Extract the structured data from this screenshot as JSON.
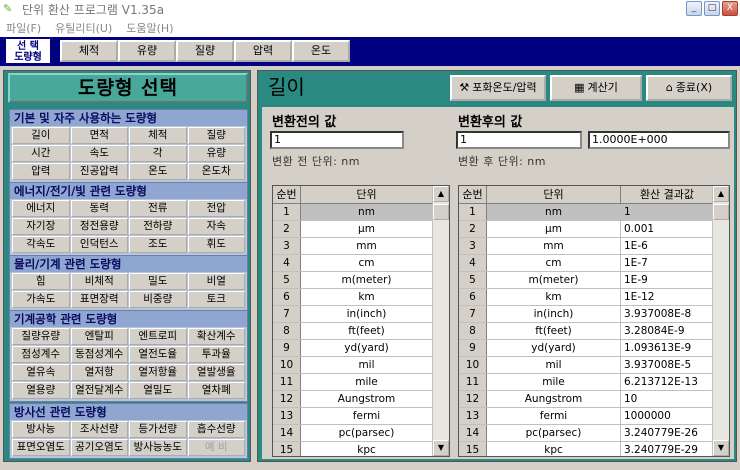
{
  "window": {
    "title": "단위 환산 프로그램 V1.35a",
    "minimize_label": "_",
    "maximize_label": "□",
    "close_label": "X"
  },
  "menu": [
    "파일(F)",
    "유틸리티(U)",
    "도움말(H)"
  ],
  "topbar": {
    "select_label_line1": "선 택",
    "select_label_line2": "도량형",
    "categories": [
      "체적",
      "유량",
      "질량",
      "압력",
      "온도"
    ]
  },
  "left_panel": {
    "header": "도량형 선택",
    "groups": [
      {
        "title": "기본 및 자주 사용하는 도량형",
        "items": [
          "길이",
          "면적",
          "체적",
          "질량",
          "시간",
          "속도",
          "각",
          "유량",
          "압력",
          "진공압력",
          "온도",
          "온도차"
        ]
      },
      {
        "title": "에너지/전기/빛 관련 도량형",
        "items": [
          "에너지",
          "동력",
          "전류",
          "전압",
          "자기장",
          "정전용량",
          "전하량",
          "자속",
          "각속도",
          "인덕턴스",
          "조도",
          "휘도"
        ]
      },
      {
        "title": "물리/기계 관련 도량형",
        "items": [
          "힘",
          "비체적",
          "밀도",
          "비열",
          "가속도",
          "표면장력",
          "비중량",
          "토크"
        ]
      },
      {
        "title": "기계공학 관련 도량형",
        "items": [
          "질량유량",
          "엔탈피",
          "엔트로피",
          "확산계수",
          "점성계수",
          "동점성계수",
          "열전도율",
          "투과율",
          "열유속",
          "열저항",
          "열저항율",
          "열발생율",
          "열용량",
          "열전달계수",
          "열밀도",
          "열차폐"
        ]
      },
      {
        "title": "방사선 관련 도량형",
        "items": [
          "방사능",
          "조사선량",
          "등가선량",
          "흡수선량",
          "표면오염도",
          "공기오염도",
          "방사능농도",
          "예 비"
        ]
      }
    ]
  },
  "right_panel": {
    "title": "길이",
    "btn_temp": "포화온도/압력",
    "btn_calc": "계산기",
    "btn_exit": "종료(X)",
    "before_label": "변환전의 값",
    "before_value": "1",
    "before_unit_label": "변환 전 단위: nm",
    "after_label": "변환후의 값",
    "after_value": "1",
    "after_result": "1.0000E+000",
    "after_unit_label": "변환 후 단위: nm"
  },
  "left_table": {
    "headers": [
      "순번",
      "단위"
    ],
    "rows": [
      [
        "1",
        "nm"
      ],
      [
        "2",
        "μm"
      ],
      [
        "3",
        "mm"
      ],
      [
        "4",
        "cm"
      ],
      [
        "5",
        "m(meter)"
      ],
      [
        "6",
        "km"
      ],
      [
        "7",
        "in(inch)"
      ],
      [
        "8",
        "ft(feet)"
      ],
      [
        "9",
        "yd(yard)"
      ],
      [
        "10",
        "mil"
      ],
      [
        "11",
        "mile"
      ],
      [
        "12",
        "Aungstrom"
      ],
      [
        "13",
        "fermi"
      ],
      [
        "14",
        "pc(parsec)"
      ],
      [
        "15",
        "kpc"
      ]
    ]
  },
  "right_table": {
    "headers": [
      "순번",
      "단위",
      "환산 결과값"
    ],
    "rows": [
      [
        "1",
        "nm",
        "1"
      ],
      [
        "2",
        "μm",
        "0.001"
      ],
      [
        "3",
        "mm",
        "1E-6"
      ],
      [
        "4",
        "cm",
        "1E-7"
      ],
      [
        "5",
        "m(meter)",
        "1E-9"
      ],
      [
        "6",
        "km",
        "1E-12"
      ],
      [
        "7",
        "in(inch)",
        "3.937008E-8"
      ],
      [
        "8",
        "ft(feet)",
        "3.28084E-9"
      ],
      [
        "9",
        "yd(yard)",
        "1.093613E-9"
      ],
      [
        "10",
        "mil",
        "3.937008E-5"
      ],
      [
        "11",
        "mile",
        "6.213712E-13"
      ],
      [
        "12",
        "Aungstrom",
        "10"
      ],
      [
        "13",
        "fermi",
        "1000000"
      ],
      [
        "14",
        "pc(parsec)",
        "3.240779E-26"
      ],
      [
        "15",
        "kpc",
        "3.240779E-29"
      ]
    ]
  }
}
